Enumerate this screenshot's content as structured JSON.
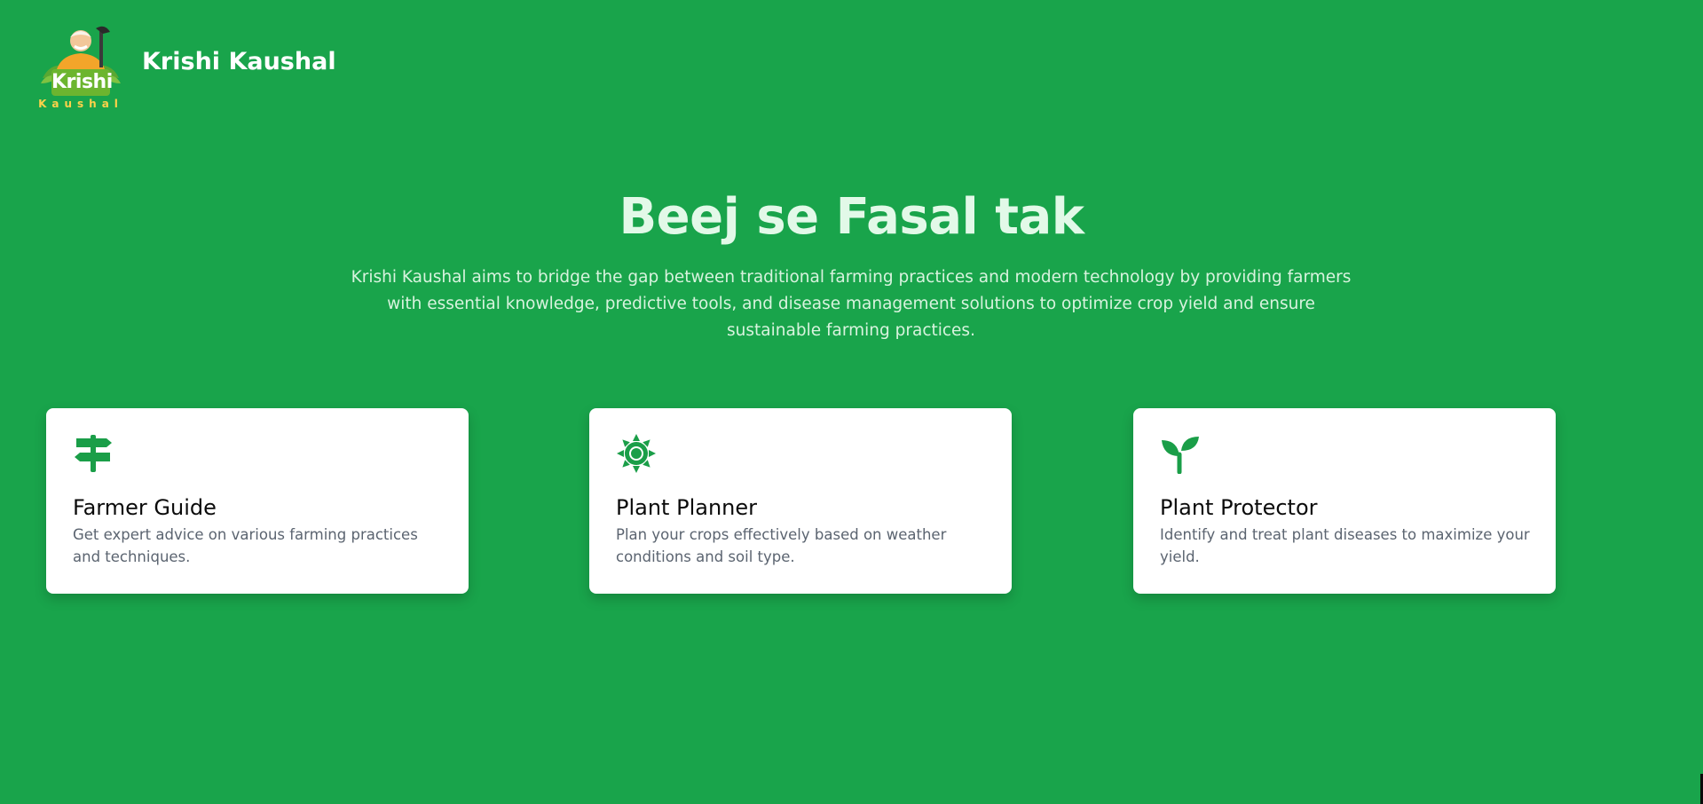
{
  "header": {
    "logo_word": "Krishi",
    "logo_subword": "Kaushal",
    "brand_name": "Krishi Kaushal"
  },
  "hero": {
    "title": "Beej se Fasal tak",
    "description": "Krishi Kaushal aims to bridge the gap between traditional farming practices and modern technology by providing farmers with essential knowledge, predictive tools, and disease management solutions to optimize crop yield and ensure sustainable farming practices."
  },
  "cards": [
    {
      "title": "Farmer Guide",
      "description": "Get expert advice on various farming practices and techniques.",
      "icon": "signpost-icon"
    },
    {
      "title": "Plant Planner",
      "description": "Plan your crops effectively based on weather conditions and soil type.",
      "icon": "sun-icon"
    },
    {
      "title": "Plant Protector",
      "description": "Identify and treat plant diseases to maximize your yield.",
      "icon": "seedling-icon"
    }
  ],
  "colors": {
    "background": "#19a44b",
    "card_icon": "#1a9e48",
    "hero_title": "#e2f9e8",
    "card_title": "#0b0b0b",
    "card_text": "#5b6470"
  }
}
